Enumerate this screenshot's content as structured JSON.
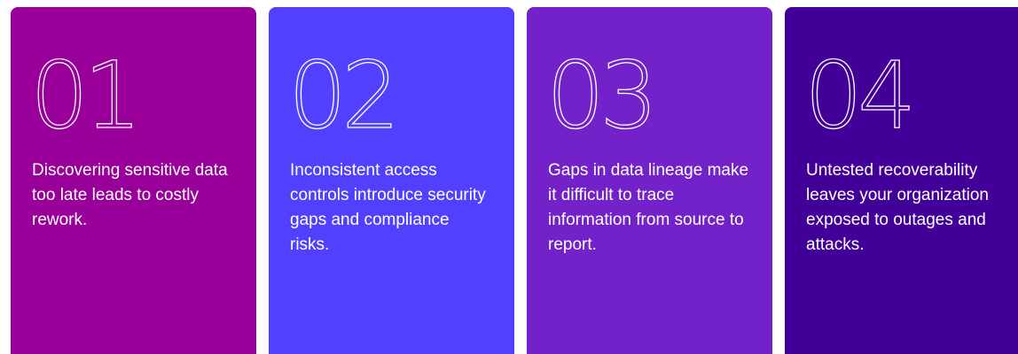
{
  "cards": [
    {
      "number": "01",
      "text": "Discovering sensitive data too late leads to costly rework.",
      "color": "#990099"
    },
    {
      "number": "02",
      "text": "Inconsistent access controls introduce security gaps and compliance risks.",
      "color": "#5240FF"
    },
    {
      "number": "03",
      "text": "Gaps in data lineage make it difficult to trace information from source to report.",
      "color": "#7322C9"
    },
    {
      "number": "04",
      "text": "Untested recoverability leaves your organization exposed to outages and attacks.",
      "color": "#430099"
    }
  ]
}
